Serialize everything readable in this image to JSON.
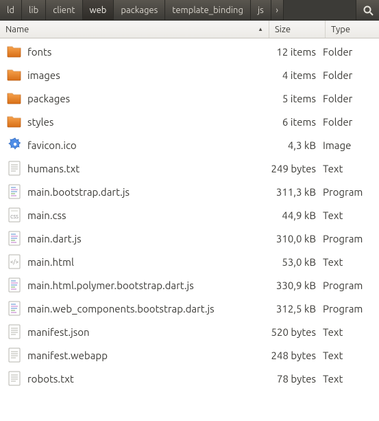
{
  "breadcrumb": {
    "items": [
      {
        "label": "ld"
      },
      {
        "label": "lib"
      },
      {
        "label": "client"
      },
      {
        "label": "web",
        "active": true
      },
      {
        "label": "packages"
      },
      {
        "label": "template_binding"
      },
      {
        "label": "js"
      }
    ],
    "overflow_glyph": "›"
  },
  "headers": {
    "name": "Name",
    "size": "Size",
    "type": "Type",
    "sort_glyph": "▲"
  },
  "files": [
    {
      "icon": "folder",
      "name": "fonts",
      "size": "12 items",
      "type": "Folder"
    },
    {
      "icon": "folder",
      "name": "images",
      "size": "4 items",
      "type": "Folder"
    },
    {
      "icon": "folder",
      "name": "packages",
      "size": "5 items",
      "type": "Folder"
    },
    {
      "icon": "folder",
      "name": "styles",
      "size": "6 items",
      "type": "Folder"
    },
    {
      "icon": "favicon",
      "name": "favicon.ico",
      "size": "4,3 kB",
      "type": "Image"
    },
    {
      "icon": "text",
      "name": "humans.txt",
      "size": "249 bytes",
      "type": "Text"
    },
    {
      "icon": "script",
      "name": "main.bootstrap.dart.js",
      "size": "311,3 kB",
      "type": "Program"
    },
    {
      "icon": "css",
      "name": "main.css",
      "size": "44,9 kB",
      "type": "Text"
    },
    {
      "icon": "script",
      "name": "main.dart.js",
      "size": "310,0 kB",
      "type": "Program"
    },
    {
      "icon": "html",
      "name": "main.html",
      "size": "53,0 kB",
      "type": "Text"
    },
    {
      "icon": "script",
      "name": "main.html.polymer.bootstrap.dart.js",
      "size": "330,9 kB",
      "type": "Program"
    },
    {
      "icon": "script",
      "name": "main.web_components.bootstrap.dart.js",
      "size": "312,5 kB",
      "type": "Program"
    },
    {
      "icon": "text",
      "name": "manifest.json",
      "size": "520 bytes",
      "type": "Text"
    },
    {
      "icon": "text",
      "name": "manifest.webapp",
      "size": "248 bytes",
      "type": "Text"
    },
    {
      "icon": "text",
      "name": "robots.txt",
      "size": "78 bytes",
      "type": "Text"
    }
  ]
}
